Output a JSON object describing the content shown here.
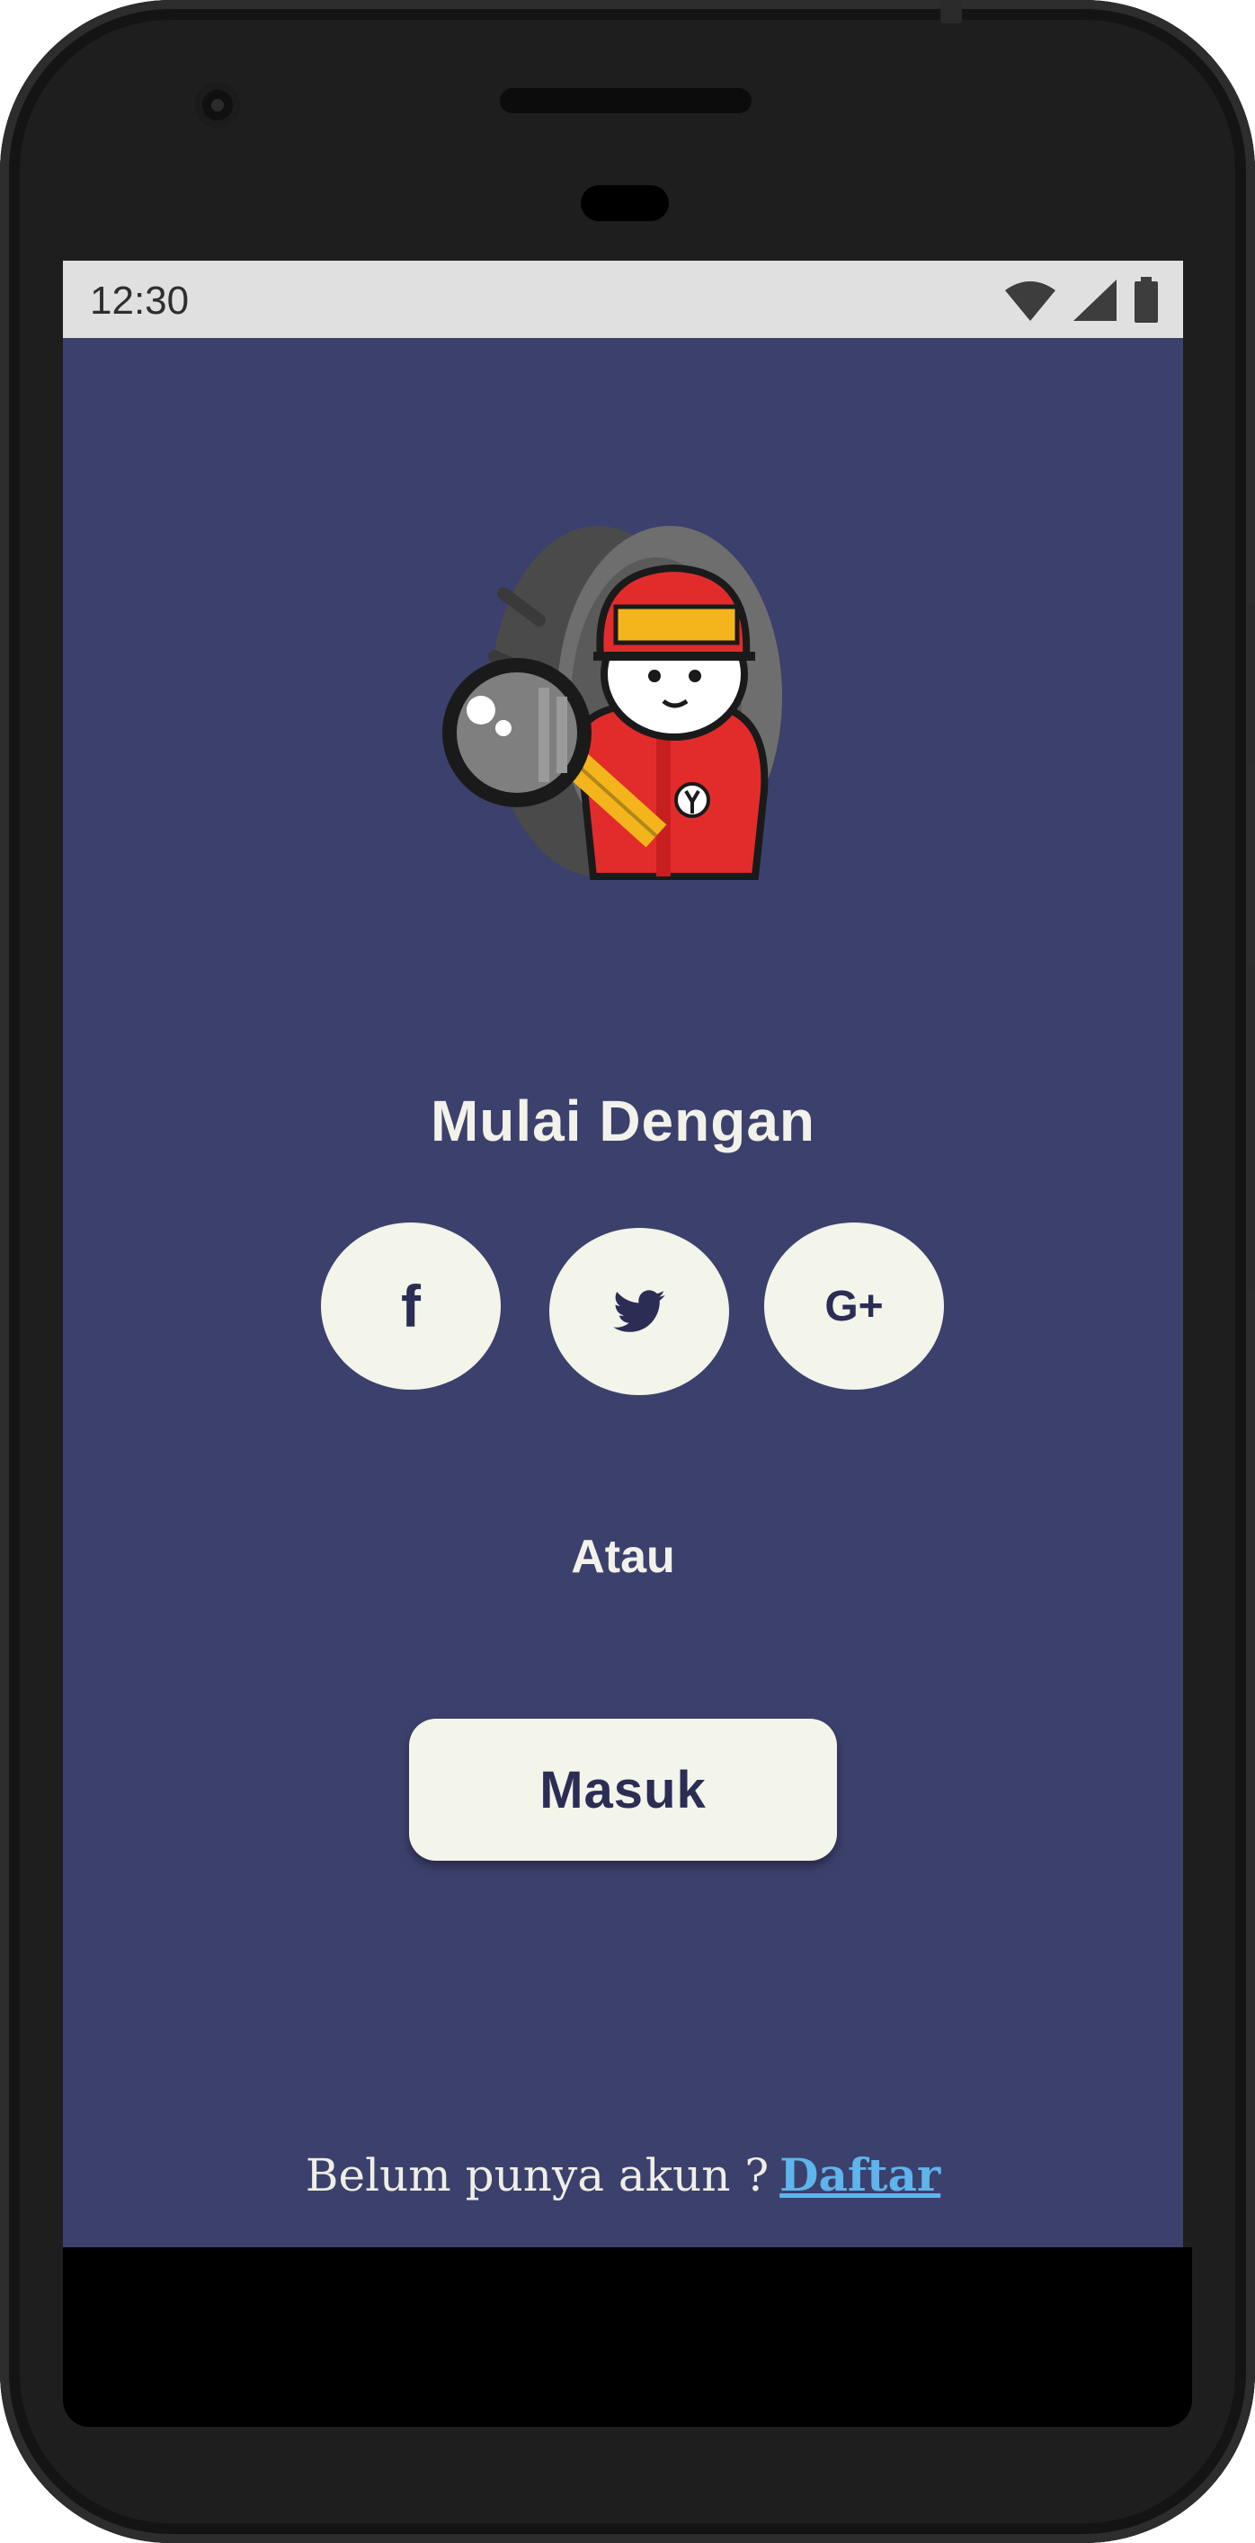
{
  "status_bar": {
    "time": "12:30"
  },
  "header": {
    "title": "Mulai Dengan"
  },
  "social": {
    "facebook_label": "f",
    "twitter_icon": "twitter-bird-icon",
    "google_label": "G+"
  },
  "divider_text": "Atau",
  "login_button": {
    "label": "Masuk"
  },
  "footer": {
    "text": "Belum punya akun ?",
    "link_label": "Daftar"
  },
  "colors": {
    "background": "#3c406c",
    "button_bg": "#f3f4ea",
    "button_text": "#2b2d55",
    "link": "#5fb4ec"
  }
}
